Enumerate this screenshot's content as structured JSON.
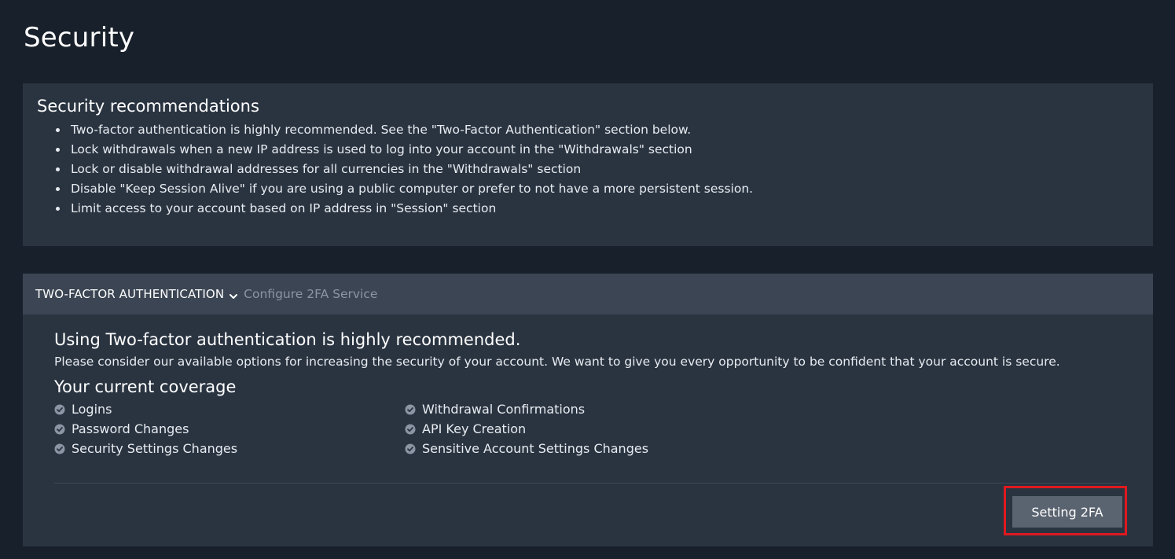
{
  "page": {
    "title": "Security"
  },
  "recommendations": {
    "title": "Security recommendations",
    "items": [
      "Two-factor authentication is highly recommended. See the \"Two-Factor Authentication\" section below.",
      "Lock withdrawals when a new IP address is used to log into your account in the \"Withdrawals\" section",
      "Lock or disable withdrawal addresses for all currencies in the \"Withdrawals\" section",
      "Disable \"Keep Session Alive\" if you are using a public computer or prefer to not have a more persistent session.",
      "Limit access to your account based on IP address in \"Session\" section"
    ]
  },
  "two_factor": {
    "header_title": "TWO-FACTOR AUTHENTICATION",
    "header_link": "Configure 2FA Service",
    "header_icon": "chevron-down-icon",
    "heading": "Using Two-factor authentication is highly recommended.",
    "description": "Please consider our available options for increasing the security of your account. We want to give you every opportunity to be confident that your account is secure.",
    "coverage_title": "Your current coverage",
    "coverage_icon": "check-circle-icon",
    "coverage_left": [
      "Logins",
      "Password Changes",
      "Security Settings Changes"
    ],
    "coverage_right": [
      "Withdrawal Confirmations",
      "API Key Creation",
      "Sensitive Account Settings Changes"
    ],
    "button_label": "Setting 2FA"
  },
  "colors": {
    "background": "#18202b",
    "panel": "#2a3441",
    "panel_header": "#3b4553",
    "button": "#5a6370",
    "highlight": "#e0191e",
    "muted_text": "#8b95a3"
  }
}
